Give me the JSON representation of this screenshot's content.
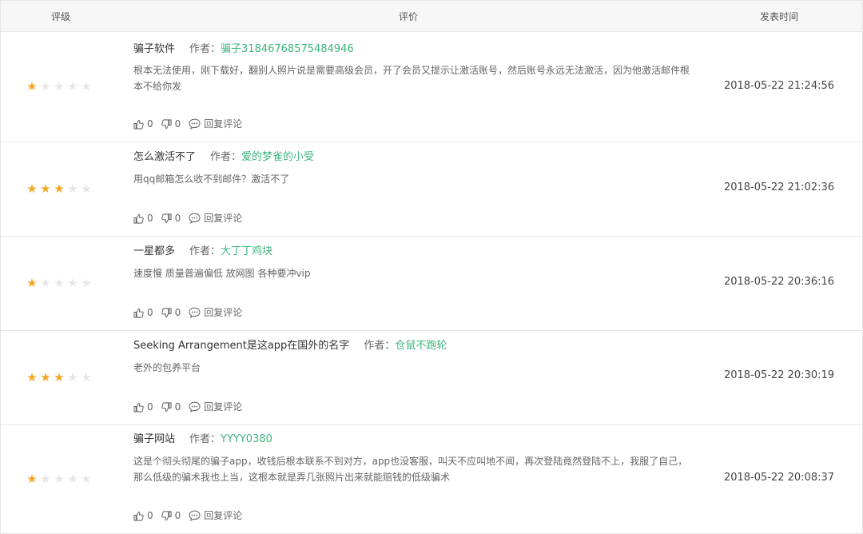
{
  "header": {
    "rating": "评级",
    "review": "评价",
    "time": "发表时间"
  },
  "labels": {
    "author_prefix": "作者：",
    "reply": "回复评论"
  },
  "colors": {
    "star_on": "#f5a623",
    "star_off": "#e6e6e6",
    "author": "#3eb57f"
  },
  "reviews": [
    {
      "stars": 1,
      "title": "骗子软件",
      "author": "骗子31846768575484946",
      "content": "根本无法使用，刚下载好，翻别人照片说是需要高级会员，开了会员又提示让激活账号，然后账号永远无法激活，因为他激活邮件根本不给你发",
      "likes": "0",
      "dislikes": "0",
      "time": "2018-05-22 21:24:56"
    },
    {
      "stars": 3,
      "title": "怎么激活不了",
      "author": "爱的梦雀的小受",
      "content": "用qq邮箱怎么收不到邮件？激活不了",
      "likes": "0",
      "dislikes": "0",
      "time": "2018-05-22 21:02:36"
    },
    {
      "stars": 1,
      "title": "一星都多",
      "author": "大丁丁鸡块",
      "content": "速度慢 质量普遍偏低 放网图 各种要冲vip",
      "likes": "0",
      "dislikes": "0",
      "time": "2018-05-22 20:36:16"
    },
    {
      "stars": 3,
      "title": "Seeking Arrangement是这app在国外的名字",
      "author": "仓鼠不跑轮",
      "content": "老外的包养平台",
      "likes": "0",
      "dislikes": "0",
      "time": "2018-05-22 20:30:19"
    },
    {
      "stars": 1,
      "title": "骗子网站",
      "author": "YYYY0380",
      "content": "这是个彻头彻尾的骗子app，收钱后根本联系不到对方，app也没客服，叫天不应叫地不闻，再次登陆竟然登陆不上，我服了自己，那么低级的骗术我也上当，这根本就是弄几张照片出来就能赔钱的低级骗术",
      "likes": "0",
      "dislikes": "0",
      "time": "2018-05-22 20:08:37"
    }
  ]
}
